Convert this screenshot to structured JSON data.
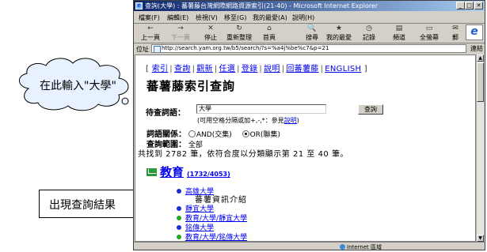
{
  "window": {
    "title": "查詢(大學) : 蕃薯藤台灣網際網路資源索引(21-40) - Microsoft Internet Explorer",
    "menu": [
      "檔案(F)",
      "編輯(E)",
      "檢視(V)",
      "移至(G)",
      "我的最愛(A)",
      "說明(H)"
    ],
    "toolbar": [
      {
        "label": "上一頁",
        "icon": "back-arrow-icon",
        "glyph": "←"
      },
      {
        "label": "下一頁",
        "icon": "forward-arrow-icon",
        "glyph": "→"
      },
      {
        "label": "停止",
        "icon": "stop-icon",
        "glyph": "✕"
      },
      {
        "label": "重新整理",
        "icon": "refresh-icon",
        "glyph": "↻"
      },
      {
        "label": "首頁",
        "icon": "home-icon",
        "glyph": "⌂"
      },
      {
        "label": "搜尋",
        "icon": "search-icon",
        "glyph": "🔍"
      },
      {
        "label": "我的最愛",
        "icon": "favorites-icon",
        "glyph": "★"
      },
      {
        "label": "記錄",
        "icon": "history-icon",
        "glyph": "◷"
      },
      {
        "label": "頻道",
        "icon": "channels-icon",
        "glyph": "▤"
      },
      {
        "label": "全螢幕",
        "icon": "fullscreen-icon",
        "glyph": "▭"
      },
      {
        "label": "郵",
        "icon": "mail-icon",
        "glyph": "✉"
      }
    ],
    "address_label": "位址",
    "address": "http://search.yam.org.tw/b5/search/?s=%a4j%be%c7&p=21",
    "go_label": "連結",
    "status_zone": "Internet 區域"
  },
  "page": {
    "nav_links": [
      "索引",
      "查詢",
      "觀新",
      "任選",
      "登錄",
      "說明",
      "回蕃薯藤",
      "ENGLISH"
    ],
    "site_title": "蕃薯藤索引查詢",
    "query_label": "待查詞語：",
    "query_value": "大學",
    "query_button": "查詢",
    "hint_text": "(可用空格分隔或加+,-,*：參見",
    "hint_link": "說明",
    "hint_end": ")",
    "relation_label": "詞語關係：",
    "relation_and": "AND(交集)",
    "relation_or": "OR(聯集)",
    "scope_label": "查詢範圍：",
    "scope_value": "全部",
    "result_summary": "共找到 2782 筆，依符合度以分類顯示第 21 至 40 筆。",
    "category_name": "教育",
    "category_count": "(1732/4053)",
    "results": [
      {
        "text": "高雄大學",
        "color": "#1a2fcf"
      },
      {
        "text": "靜宜大學",
        "color": "#1a2fcf"
      },
      {
        "text": "教育/大學/靜宜大學",
        "color": "#1fa82a"
      },
      {
        "text": "銘傳大學",
        "color": "#1a2fcf"
      },
      {
        "text": "教育/大學/銘傳大學",
        "color": "#1fa82a"
      }
    ],
    "result_sub": "蕃薯資訊介紹"
  },
  "annotations": {
    "cloud_text": "在此輸入\"大學\"",
    "box_text": "出現查詢結果"
  },
  "colors": {
    "link": "#0000ee",
    "title_bar": "#0a246a",
    "category_icon": "#2a9a3a"
  }
}
